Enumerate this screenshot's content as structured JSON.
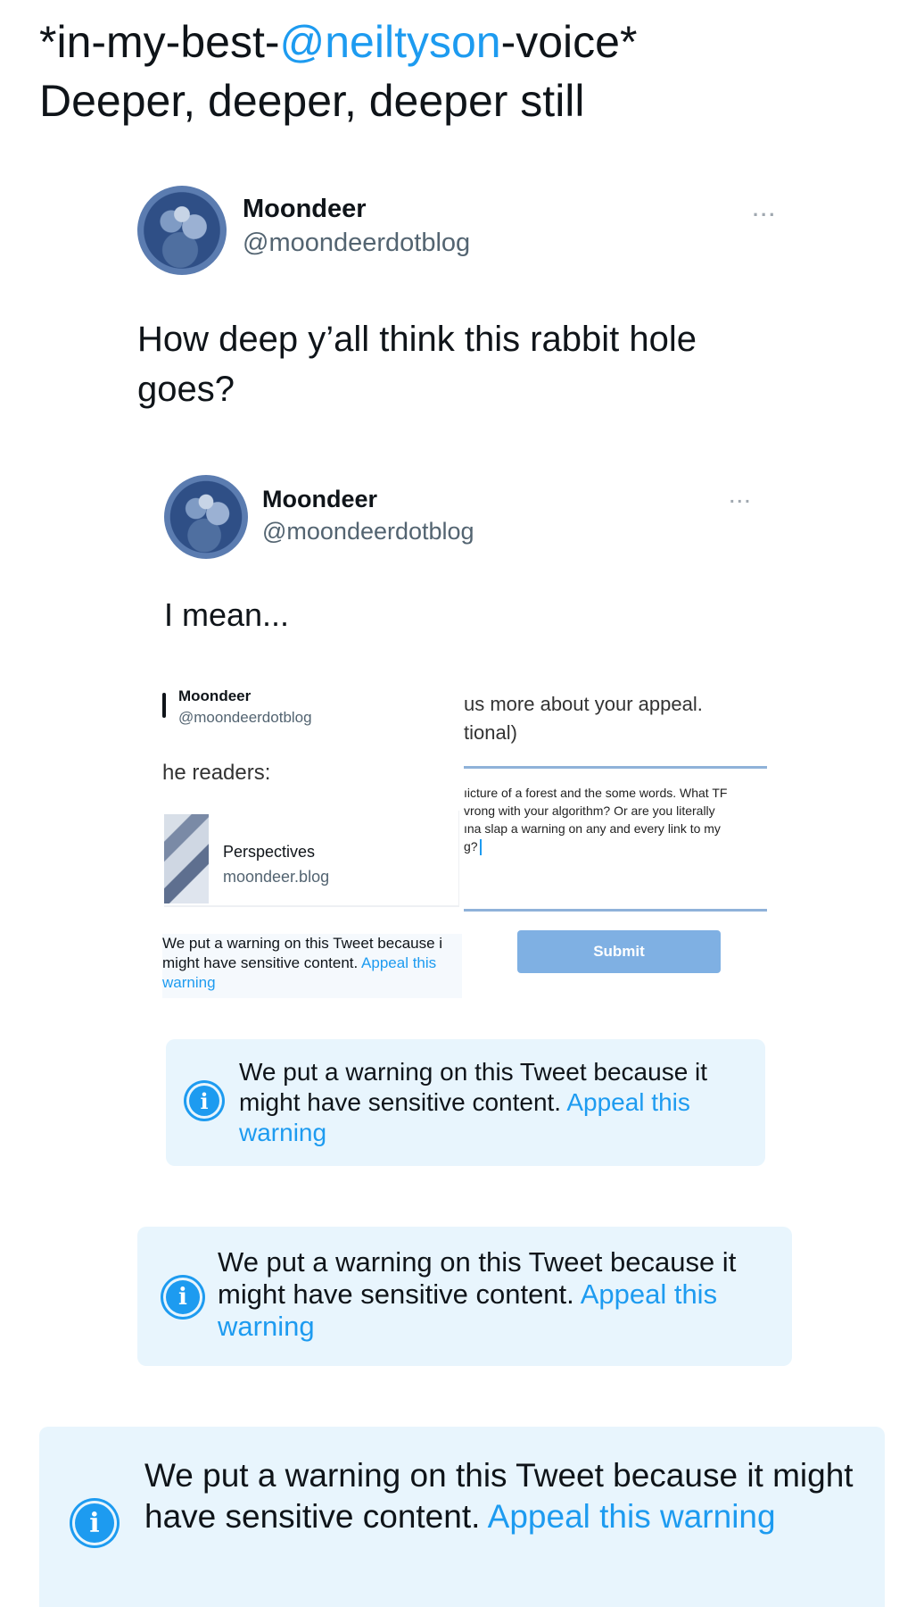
{
  "post": {
    "line1_prefix": "*in-my-best-",
    "line1_mention": "@neiltyson",
    "line1_suffix": "-voice*",
    "line2": "Deeper, deeper, deeper still"
  },
  "outer_tweet": {
    "name": "Moondeer",
    "handle": "@moondeerdotblog",
    "more": "...",
    "text": "How deep y’all think this rabbit hole goes?"
  },
  "inner_tweet": {
    "name": "Moondeer",
    "handle": "@moondeerdotblog",
    "more": "...",
    "text": "I mean..."
  },
  "nested_screenshot": {
    "name": "Moondeer",
    "handle": "@moondeerdotblog",
    "readers_text": "he readers:",
    "card_title": "Perspectives",
    "card_domain": "moondeer.blog",
    "small_warning_text": "We put a warning on this Tweet because i might have sensitive content.",
    "small_warning_link": "Appeal this warning",
    "appeal_prompt_line1": "us more about your appeal.",
    "appeal_prompt_line2": "tional)",
    "appeal_body_1": "ıicture of a forest and the some words. What TF",
    "appeal_body_2": "vrong with your algorithm? Or are you literally",
    "appeal_body_3": "ına slap a warning on any and every link to my",
    "appeal_body_4": "g?",
    "submit_label": "Submit"
  },
  "warnings": [
    {
      "text": "We put a warning on this Tweet because it might have sensitive content.",
      "link": "Appeal this warning"
    },
    {
      "text": "We put a warning on this Tweet because it might have sensitive content.",
      "link": "Appeal this warning"
    },
    {
      "text": "We put a warning on this Tweet because it might have sensitive content.",
      "link": "Appeal this warning"
    }
  ],
  "icons": {
    "info": "info-icon",
    "more": "more-dots-icon",
    "avatar": "avatar"
  },
  "colors": {
    "link": "#1d9bf0",
    "warning_bg": "#e8f5fd",
    "submit_bg": "#7fb0e3"
  }
}
